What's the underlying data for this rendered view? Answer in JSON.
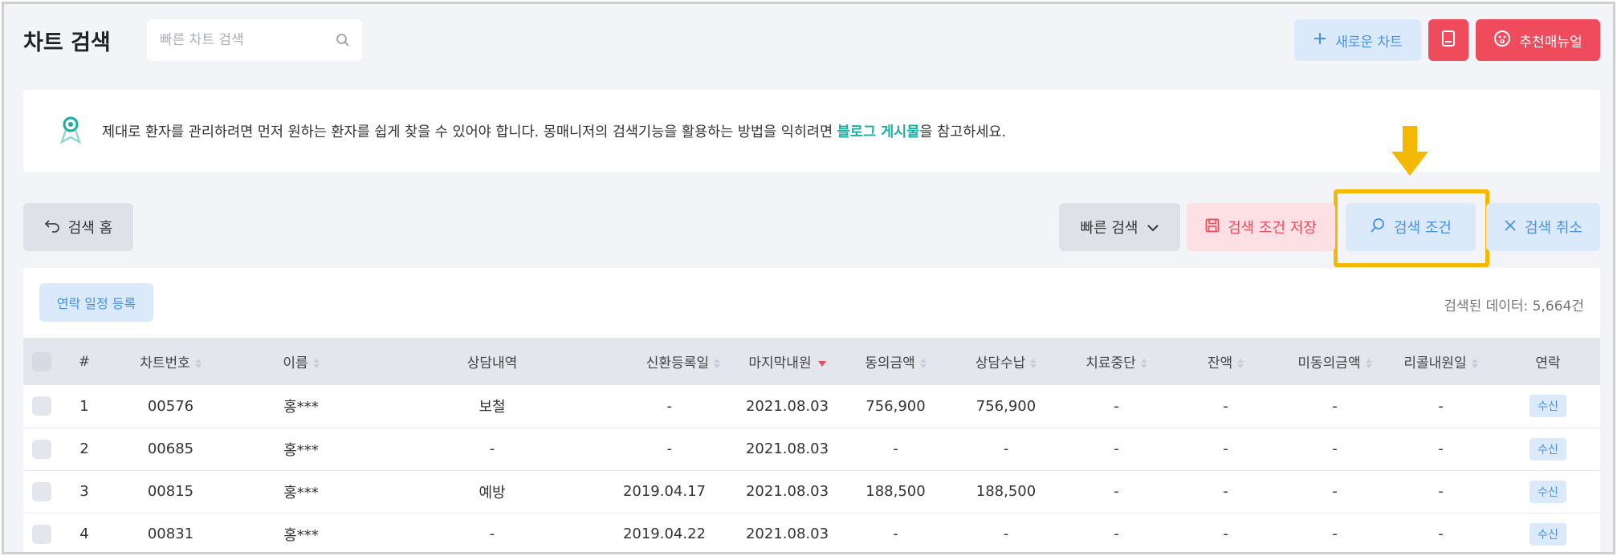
{
  "header": {
    "title": "차트 검색",
    "search_placeholder": "빠른 차트 검색",
    "new_chart_label": "새로운 차트",
    "manual_label": "추천매뉴얼"
  },
  "banner": {
    "text_before": "제대로 환자를 관리하려면 먼저 원하는 환자를 쉽게 찾을 수 있어야 합니다. 몽매니저의 검색기능을 활용하는 방법을 익히려면 ",
    "link_text": "블로그 게시물",
    "text_after": "을 참고하세요."
  },
  "toolbar": {
    "search_home": "검색 홈",
    "quick_search": "빠른 검색",
    "save_condition": "검색 조건 저장",
    "search_condition": "검색 조건",
    "search_cancel": "검색 취소"
  },
  "list": {
    "contact_schedule_label": "연락 일정 등록",
    "result_count": "검색된 데이터: 5,664건",
    "columns": [
      "#",
      "차트번호",
      "이름",
      "상담내역",
      "신환등록일",
      "마지막내원",
      "동의금액",
      "상담수납",
      "치료중단",
      "잔액",
      "미동의금액",
      "리콜내원일",
      "연락"
    ],
    "rows": [
      {
        "idx": "1",
        "chart_no": "00576",
        "name": "홍***",
        "consult": "보철",
        "reg_date": "-",
        "last_visit": "2021.08.03",
        "agreed": "756,900",
        "paid": "756,900",
        "stopped": "-",
        "balance": "-",
        "unagreed": "-",
        "recall": "-",
        "contact": "수신"
      },
      {
        "idx": "2",
        "chart_no": "00685",
        "name": "홍***",
        "consult": "-",
        "reg_date": "-",
        "last_visit": "2021.08.03",
        "agreed": "-",
        "paid": "-",
        "stopped": "-",
        "balance": "-",
        "unagreed": "-",
        "recall": "-",
        "contact": "수신"
      },
      {
        "idx": "3",
        "chart_no": "00815",
        "name": "홍***",
        "consult": "예방",
        "reg_date": "2019.04.17",
        "last_visit": "2021.08.03",
        "agreed": "188,500",
        "paid": "188,500",
        "stopped": "-",
        "balance": "-",
        "unagreed": "-",
        "recall": "-",
        "contact": "수신"
      },
      {
        "idx": "4",
        "chart_no": "00831",
        "name": "홍***",
        "consult": "-",
        "reg_date": "2019.04.22",
        "last_visit": "2021.08.03",
        "agreed": "-",
        "paid": "-",
        "stopped": "-",
        "balance": "-",
        "unagreed": "-",
        "recall": "-",
        "contact": "수신"
      }
    ]
  },
  "colors": {
    "accent_teal": "#1aaea0",
    "accent_blue": "#4a90e2",
    "accent_red": "#ee4b5c",
    "highlight_yellow": "#f5b800"
  },
  "icons": [
    "search-icon",
    "plus-icon",
    "book-icon",
    "face-icon",
    "pin-icon",
    "undo-icon",
    "chevron-down-icon",
    "floppy-icon",
    "close-icon",
    "arrow-down-icon"
  ]
}
